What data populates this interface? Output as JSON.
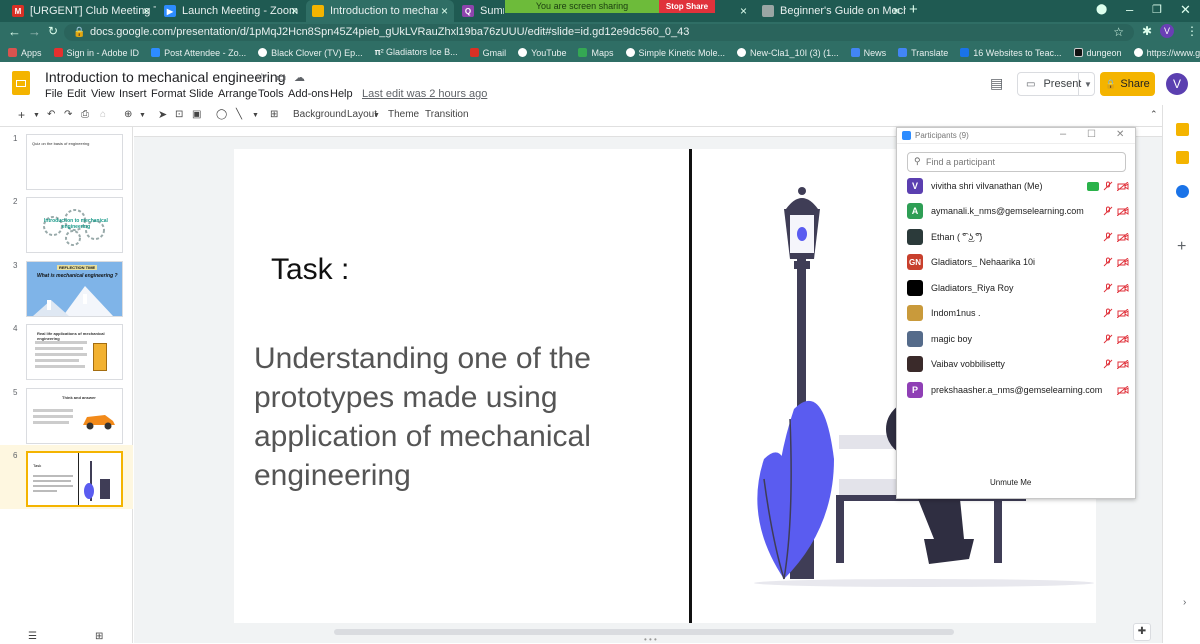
{
  "browser": {
    "tabs": [
      {
        "label": "[URGENT] Club Meeting Tomorro",
        "favicon": "gmail-icon"
      },
      {
        "label": "Launch Meeting - Zoom",
        "favicon": "zoom-icon"
      },
      {
        "label": "Introduction to mechanical engi",
        "favicon": "slides-icon"
      },
      {
        "label": "Summar",
        "favicon": "quizizz-icon"
      },
      {
        "label": "",
        "favicon": "page-icon"
      },
      {
        "label": "Beginner's Guide on Mechanical",
        "favicon": "page-icon"
      }
    ],
    "url": "docs.google.com/presentation/d/1pMqJ2Hcn8Spn45Z4pieb_gUkLVRauZhxl19ba76zUUU/edit#slide=id.gd12e9dc560_0_43",
    "profile_initial": "V",
    "bookmarks": [
      "Apps",
      "Sign in - Adobe ID",
      "Post Attendee - Zo...",
      "Black Clover (TV) Ep...",
      "𝛑² Gladiators Ice B...",
      "Gmail",
      "YouTube",
      "Maps",
      "Simple Kinetic Mole...",
      "New-Cla1_10I (3) (1...",
      "News",
      "Translate",
      "16 Websites to Teac...",
      "dungeon",
      "https://www.gcegui..."
    ]
  },
  "screen_share": {
    "banner": "You are screen sharing",
    "stop": "Stop Share"
  },
  "doc": {
    "title": "Introduction to mechanical engineering",
    "menus": [
      "File",
      "Edit",
      "View",
      "Insert",
      "Format",
      "Slide",
      "Arrange",
      "Tools",
      "Add-ons",
      "Help"
    ],
    "last_edit": "Last edit was 2 hours ago",
    "present": "Present",
    "share": "Share",
    "avatar_initial": "V"
  },
  "toolbar": {
    "background": "Background",
    "layout": "Layout",
    "theme": "Theme",
    "transition": "Transition"
  },
  "filmstrip": [
    {
      "num": "1",
      "text": "Quiz on the basis of engineering"
    },
    {
      "num": "2",
      "text": "Introduction to mechanical engineering"
    },
    {
      "num": "3",
      "text": "What is mechanical engineering ?"
    },
    {
      "num": "4",
      "text": "Real life applications of mechanical engineering"
    },
    {
      "num": "5",
      "text": "Think and answer"
    },
    {
      "num": "6",
      "text": "Task"
    }
  ],
  "slide": {
    "heading": "Task :",
    "body_lines": [
      "Understanding one of the",
      "prototypes made using",
      "application of mechanical",
      "engineering"
    ]
  },
  "participants": {
    "title": "Participants (9)",
    "search_placeholder": "Find a participant",
    "unmute": "Unmute Me",
    "list": [
      {
        "name": "vivitha shri vilvanathan (Me)",
        "initials": "V",
        "color": "#5b3fb0"
      },
      {
        "name": "aymanali.k_nms@gemselearning.com",
        "initials": "A",
        "color": "#2e9e55"
      },
      {
        "name": "Ethan ( ͡° ͜ʖ ͡°)",
        "initials": "",
        "color": "#2b3a3a"
      },
      {
        "name": "Gladiators_ Nehaarika 10i",
        "initials": "GN",
        "color": "#c8402d"
      },
      {
        "name": "Gladiators_Riya Roy",
        "initials": "",
        "color": "#000000"
      },
      {
        "name": "Indom1nus .",
        "initials": "",
        "color": "#c99a3b"
      },
      {
        "name": "magic boy",
        "initials": "",
        "color": "#556b8a"
      },
      {
        "name": "Vaibav vobbilisetty",
        "initials": "",
        "color": "#3a2a2a"
      },
      {
        "name": "prekshaasher.a_nms@gemselearning.com",
        "initials": "P",
        "color": "#8f3fb5"
      }
    ]
  }
}
